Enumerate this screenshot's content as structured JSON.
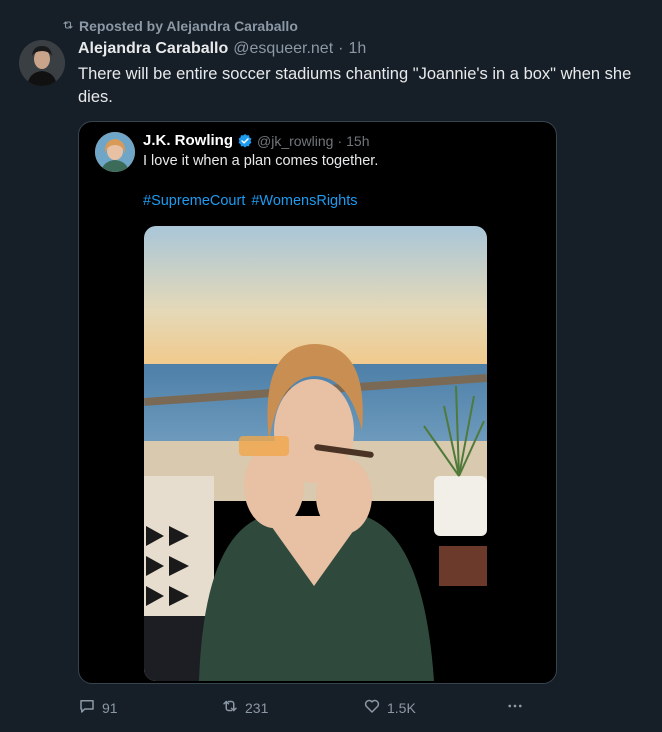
{
  "repost": {
    "label": "Reposted by Alejandra Caraballo"
  },
  "post": {
    "author_name": "Alejandra Caraballo",
    "author_handle": "@esqueer.net",
    "separator": "·",
    "time": "1h",
    "text": "There will be entire soccer stadiums chanting \"Joannie's in a box\" when she dies."
  },
  "quote": {
    "author_name": "J.K. Rowling",
    "author_handle": "@jk_rowling",
    "separator": "·",
    "time": "15h",
    "text": "I love it when a plan comes together.",
    "hashtags": [
      "#SupremeCourt",
      "#WomensRights"
    ]
  },
  "actions": {
    "replies": "91",
    "reposts": "231",
    "likes": "1.5K"
  },
  "colors": {
    "background": "#161e27",
    "link": "#1d9bf0",
    "muted": "#8b98a5"
  }
}
